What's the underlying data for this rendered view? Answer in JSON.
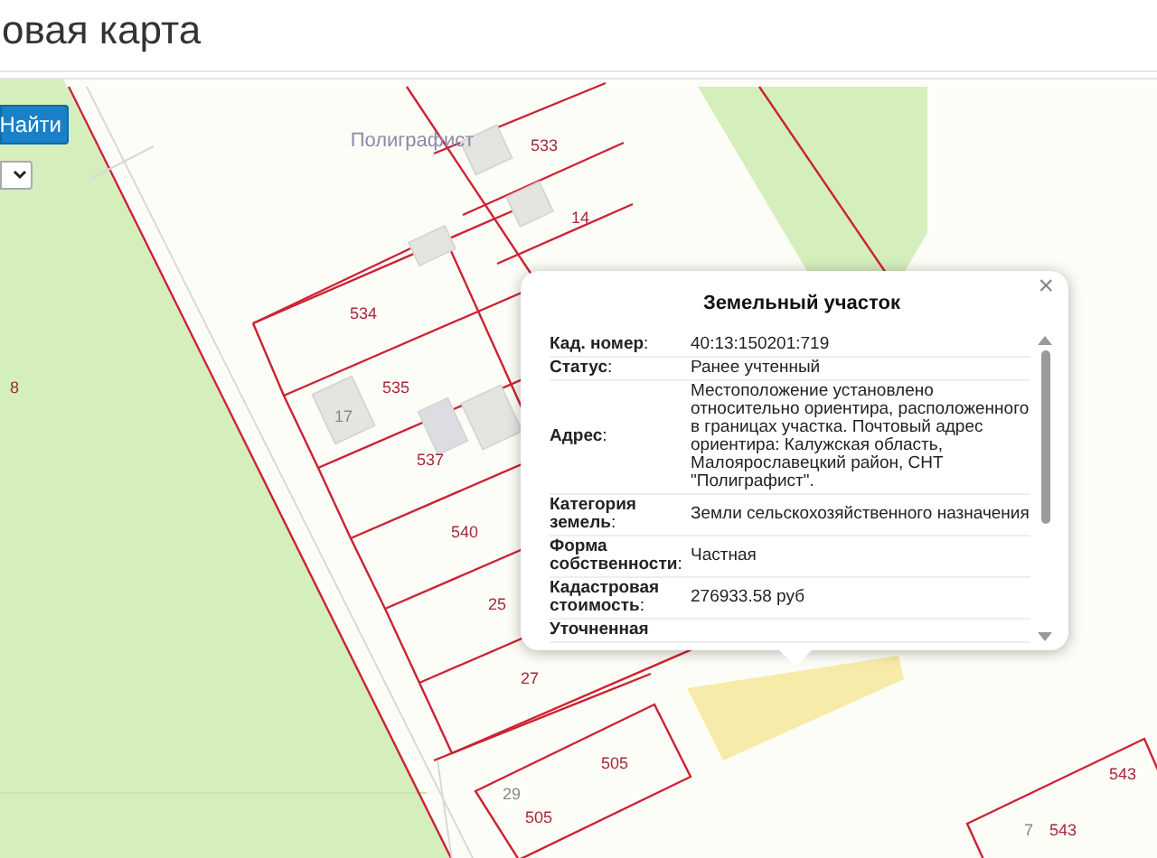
{
  "header": {
    "title": "овая карта"
  },
  "search": {
    "button": "Найти"
  },
  "map": {
    "labels": [
      {
        "text": "Полиграфист",
        "kind": "place"
      },
      {
        "text": "533",
        "kind": "parcel"
      },
      {
        "text": "14",
        "kind": "parcel"
      },
      {
        "text": "534",
        "kind": "parcel"
      },
      {
        "text": "535",
        "kind": "parcel"
      },
      {
        "text": "17",
        "kind": "house"
      },
      {
        "text": "537",
        "kind": "parcel"
      },
      {
        "text": "540",
        "kind": "parcel"
      },
      {
        "text": "25",
        "kind": "parcel"
      },
      {
        "text": "27",
        "kind": "parcel"
      },
      {
        "text": "8",
        "kind": "parcel"
      },
      {
        "text": "29",
        "kind": "house"
      },
      {
        "text": "505",
        "kind": "parcel"
      },
      {
        "text": "505",
        "kind": "parcel"
      },
      {
        "text": "543",
        "kind": "parcel"
      },
      {
        "text": "7",
        "kind": "house"
      },
      {
        "text": "543",
        "kind": "parcel"
      }
    ]
  },
  "popup": {
    "title": "Земельный участок",
    "close": "×",
    "rows": [
      {
        "label": "**Кад. номер**:",
        "value": "40:13:150201:719"
      },
      {
        "label": "**Статус**:",
        "value": "Ранее учтенный"
      },
      {
        "label": "**Адрес**:",
        "value": "Местоположение установлено относительно ориентира, расположенного в границах участка. Почтовый адрес ориентира: Калужская область, Малоярославецкий район, СНТ \"Полиграфист\"."
      },
      {
        "label": "**Категория земель**:",
        "value": "Земли сельскохозяйственного назначения"
      },
      {
        "label": "**Форма собственности**:",
        "value": "Частная"
      },
      {
        "label": "**Кадастровая стоимость**:",
        "value": "276933.58 руб"
      },
      {
        "label": "**Уточненная**"
      }
    ]
  }
}
